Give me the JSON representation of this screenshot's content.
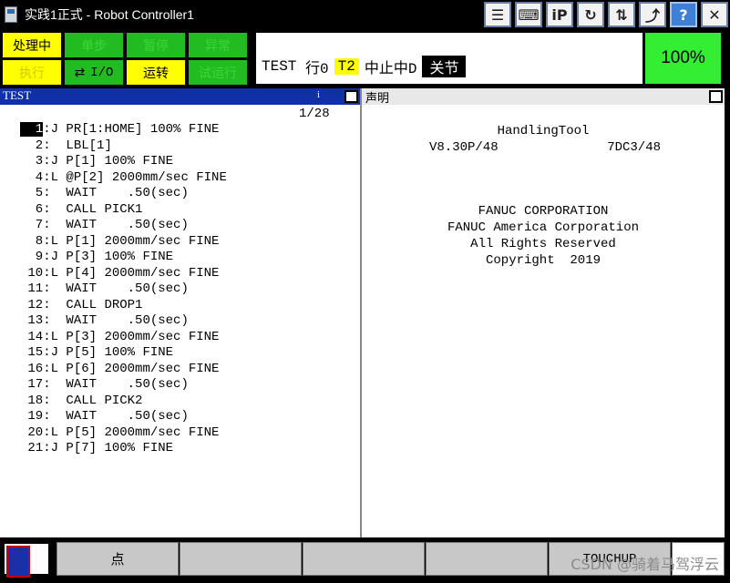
{
  "window": {
    "title": "实践1正式 - Robot Controller1",
    "toolbar_icons": [
      "list-icon",
      "keyboard-icon",
      "ip-icon",
      "refresh-icon",
      "io-icon",
      "exit-icon",
      "help-icon",
      "close-icon"
    ],
    "ip_label": "iP",
    "refresh_label": "↻",
    "help_label": "?",
    "close_label": "✕"
  },
  "status": {
    "lamps": {
      "busy": "处理中",
      "step": "单步",
      "hold": "暂停",
      "fault": "异常",
      "run": "执行",
      "io": "I/O",
      "prod": "运转",
      "tcyc": "试运行"
    },
    "program": "TEST",
    "line_text": "行0",
    "mode": "T2",
    "state": "中止中D",
    "coord": "关节",
    "override": "100%"
  },
  "left_panel": {
    "title": "TEST",
    "line_count": "1/28",
    "lines": [
      {
        "no": "1",
        "sep": ":J",
        "text": " PR[1:HOME] 100% FINE"
      },
      {
        "no": "2",
        "sep": ": ",
        "text": " LBL[1]"
      },
      {
        "no": "3",
        "sep": ":J",
        "text": " P[1] 100% FINE"
      },
      {
        "no": "4",
        "sep": ":L",
        "text": " @P[2] 2000mm/sec FINE"
      },
      {
        "no": "5",
        "sep": ": ",
        "text": " WAIT    .50(sec)"
      },
      {
        "no": "6",
        "sep": ": ",
        "text": " CALL PICK1"
      },
      {
        "no": "7",
        "sep": ": ",
        "text": " WAIT    .50(sec)"
      },
      {
        "no": "8",
        "sep": ":L",
        "text": " P[1] 2000mm/sec FINE"
      },
      {
        "no": "9",
        "sep": ":J",
        "text": " P[3] 100% FINE"
      },
      {
        "no": "10",
        "sep": ":L",
        "text": " P[4] 2000mm/sec FINE"
      },
      {
        "no": "11",
        "sep": ": ",
        "text": " WAIT    .50(sec)"
      },
      {
        "no": "12",
        "sep": ": ",
        "text": " CALL DROP1"
      },
      {
        "no": "13",
        "sep": ": ",
        "text": " WAIT    .50(sec)"
      },
      {
        "no": "14",
        "sep": ":L",
        "text": " P[3] 2000mm/sec FINE"
      },
      {
        "no": "15",
        "sep": ":J",
        "text": " P[5] 100% FINE"
      },
      {
        "no": "16",
        "sep": ":L",
        "text": " P[6] 2000mm/sec FINE"
      },
      {
        "no": "17",
        "sep": ": ",
        "text": " WAIT    .50(sec)"
      },
      {
        "no": "18",
        "sep": ": ",
        "text": " CALL PICK2"
      },
      {
        "no": "19",
        "sep": ": ",
        "text": " WAIT    .50(sec)"
      },
      {
        "no": "20",
        "sep": ":L",
        "text": " P[5] 2000mm/sec FINE"
      },
      {
        "no": "21",
        "sep": ":J",
        "text": " P[7] 100% FINE"
      }
    ]
  },
  "right_panel": {
    "title": "声明",
    "product": "HandlingTool",
    "version": "V8.30P/48",
    "build": "7DC3/48",
    "company1": "FANUC CORPORATION",
    "company2": "FANUC America Corporation",
    "rights": "All Rights Reserved",
    "copyright": "Copyright  2019"
  },
  "function_keys": {
    "f1": "点",
    "f2": "",
    "f3": "",
    "f4": "",
    "f5": "TOUCHUP"
  },
  "watermark": "CSDN @骑着马驾浮云"
}
